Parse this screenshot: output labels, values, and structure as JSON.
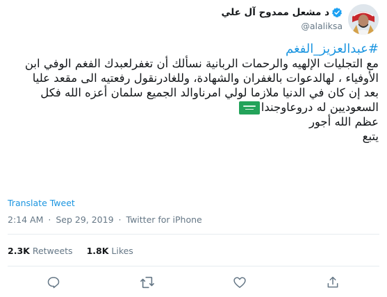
{
  "tweet": {
    "author": {
      "display_name": "د مشعل ممدوح آل علي",
      "handle": "@alaliksa",
      "verified": true
    },
    "lines": [
      "#عبدالعزيز_الفغم",
      "مع التجليات الإلهيه والرحمات الربانية نسألك أن تغفرلعبدك الفغم الوفي ابن",
      "الأوفياء ، لهالدعوات بالغفران والشهادة، وللغادرنقول رفعتيه الى مقعد عليا",
      "بعد إن كان في الدنيا ملازما لولي امرناوالد الجميع سلمان أعزه الله فكل",
      "السعوديين له دروعاوجندا",
      "عظم الله أجور",
      "يتبع"
    ],
    "emoji": "saudi-arabia-flag",
    "translate_label": "Translate Tweet",
    "time": "2:14 AM",
    "date": "Sep 29, 2019",
    "source": "Twitter for iPhone",
    "meta_separator": "·",
    "retweets_count": "2.3K",
    "retweets_label": "Retweets",
    "likes_count": "1.8K",
    "likes_label": "Likes"
  },
  "colors": {
    "link": "#1b95e0",
    "text": "#14171a",
    "muted": "#657786",
    "divider": "#e6ecf0",
    "flag_green": "#23a35a"
  },
  "icons": [
    "verified-badge-icon",
    "reply-icon",
    "retweet-icon",
    "like-icon",
    "share-icon"
  ]
}
